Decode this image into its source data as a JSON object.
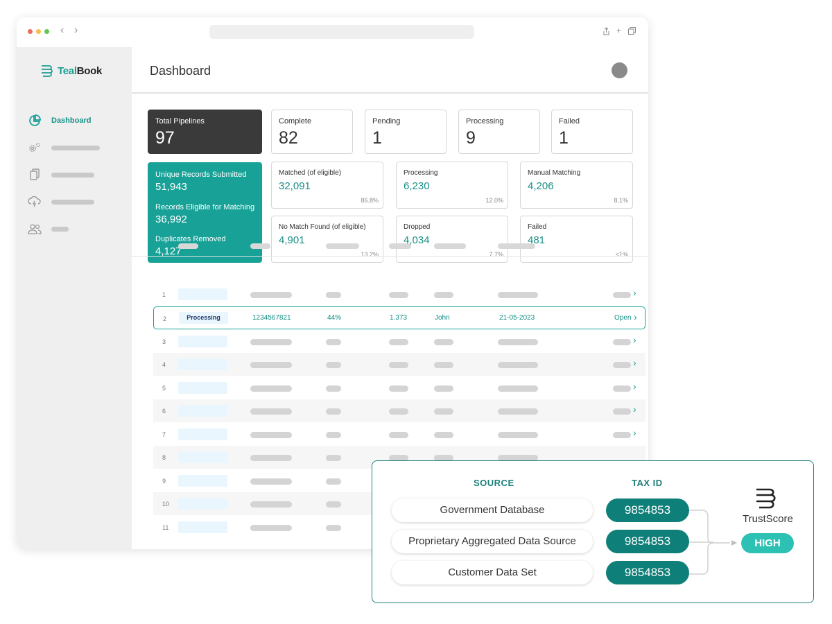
{
  "app": {
    "logo_text_a": "Teal",
    "logo_text_b": "Book",
    "page_title": "Dashboard"
  },
  "sidebar": {
    "active_label": "Dashboard"
  },
  "summary": [
    {
      "label": "Total Pipelines",
      "value": "97"
    },
    {
      "label": "Complete",
      "value": "82"
    },
    {
      "label": "Pending",
      "value": "1"
    },
    {
      "label": "Processing",
      "value": "9"
    },
    {
      "label": "Failed",
      "value": "1"
    }
  ],
  "records": {
    "unique_label": "Unique Records Submitted",
    "unique_value": "51,943",
    "eligible_label": "Records Eligible for Matching",
    "eligible_value": "36,992",
    "dupes_label": "Duplicates Removed",
    "dupes_value": "4,127"
  },
  "stats": [
    {
      "label": "Matched (of eligible)",
      "value": "32,091",
      "pct": "86.8%"
    },
    {
      "label": "Processing",
      "value": "6,230",
      "pct": "12.0%"
    },
    {
      "label": "Manual Matching",
      "value": "4,206",
      "pct": "8.1%"
    },
    {
      "label": "No Match Found (of eligible)",
      "value": "4,901",
      "pct": "13.2%"
    },
    {
      "label": "Dropped",
      "value": "4,034",
      "pct": "7.7%"
    },
    {
      "label": "Failed",
      "value": "481",
      "pct": "<1%"
    }
  ],
  "table": {
    "row_numbers": [
      "1",
      "2",
      "3",
      "4",
      "5",
      "6",
      "7",
      "8",
      "9",
      "10",
      "11"
    ],
    "highlight": {
      "status": "Processing",
      "id": "1234567821",
      "percent": "44%",
      "count": "1.373",
      "user": "John",
      "date": "21-05-2023",
      "action": "Open"
    }
  },
  "trust": {
    "source_header": "SOURCE",
    "taxid_header": "TAX ID",
    "sources": [
      "Government Database",
      "Proprietary Aggregated Data Source",
      "Customer Data Set"
    ],
    "tax_ids": [
      "9854853",
      "9854853",
      "9854853"
    ],
    "name": "TrustScore",
    "level": "HIGH"
  }
}
